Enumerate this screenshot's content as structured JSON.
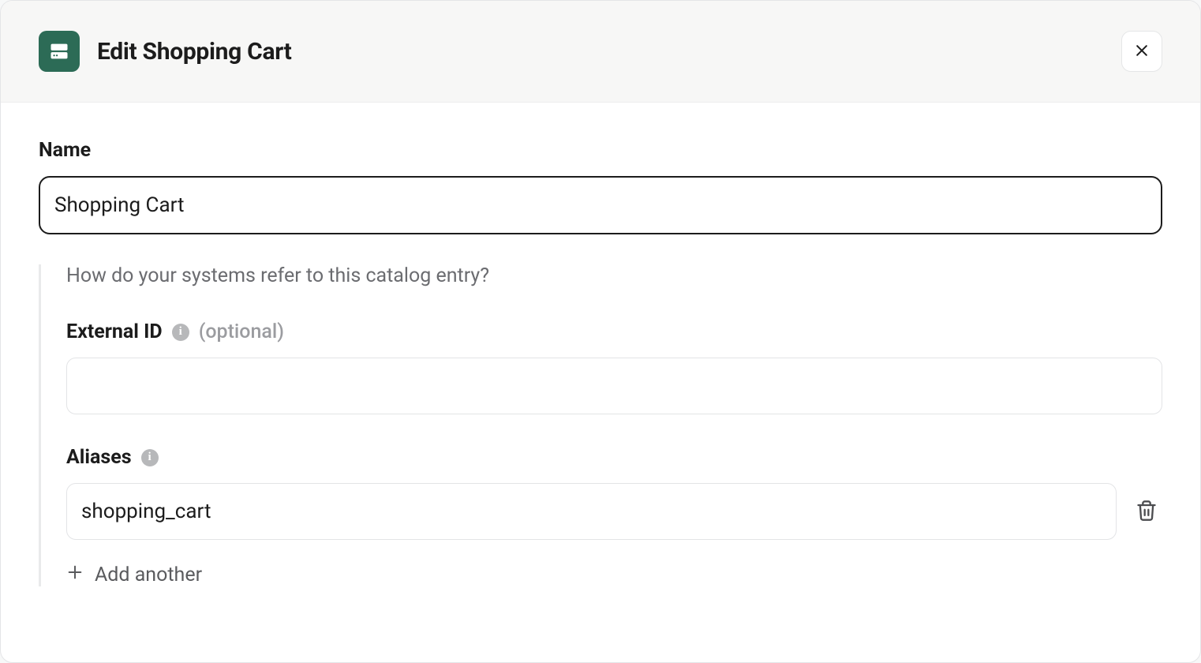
{
  "header": {
    "title": "Edit Shopping Cart"
  },
  "form": {
    "name": {
      "label": "Name",
      "value": "Shopping Cart"
    },
    "helper": "How do your systems refer to this catalog entry?",
    "external_id": {
      "label": "External ID",
      "optional_tag": "(optional)",
      "value": ""
    },
    "aliases": {
      "label": "Aliases",
      "items": [
        {
          "value": "shopping_cart"
        }
      ],
      "add_label": "Add another"
    }
  }
}
